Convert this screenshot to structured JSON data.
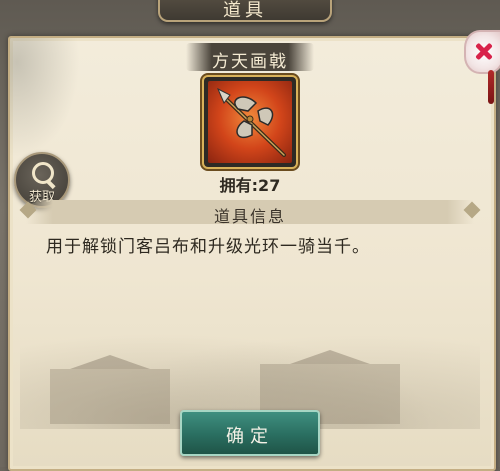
{
  "window": {
    "title": "道具"
  },
  "item": {
    "name": "方天画戟",
    "owned_label": "拥有:27",
    "icon": "halberd-icon"
  },
  "actions": {
    "get_label": "获取",
    "confirm_label": "确定"
  },
  "info": {
    "header": "道具信息",
    "description": "用于解锁门客吕布和升级光环一骑当千。"
  },
  "colors": {
    "panel": "#efe6d1",
    "confirm_button": "#2a6e60",
    "item_frame": "#d9b25a",
    "item_background": "#d2451a",
    "close_icon": "#d8224a"
  }
}
